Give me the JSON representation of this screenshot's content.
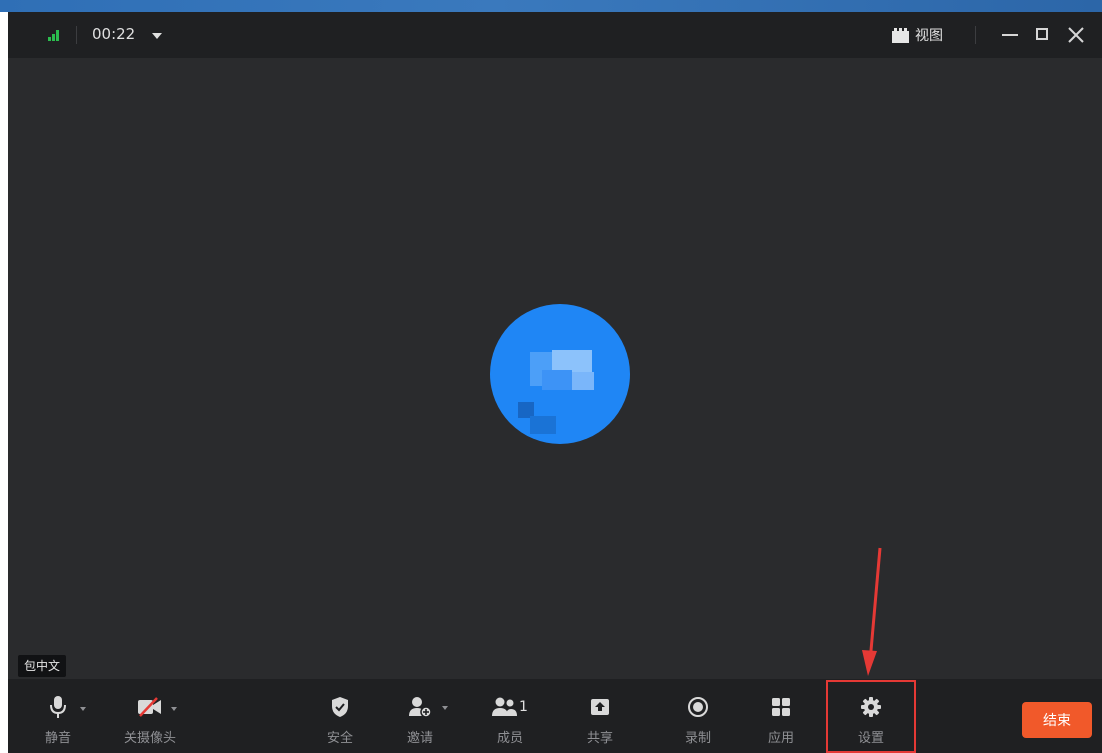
{
  "titlebar": {
    "timer": "00:22",
    "view_label": "视图"
  },
  "participant": {
    "name_tag": "包中文"
  },
  "toolbar": {
    "mute": "静音",
    "camera_off": "关摄像头",
    "security": "安全",
    "invite": "邀请",
    "members": "成员",
    "members_count": "1",
    "share": "共享",
    "record": "录制",
    "apps": "应用",
    "settings": "设置",
    "end": "结束"
  },
  "colors": {
    "accent": "#1f86f5",
    "end_button": "#f1592a",
    "annotation": "#e53935",
    "signal": "#2bbd4e"
  },
  "icons": [
    "signal-icon",
    "chevron-down-icon",
    "view-grid-icon",
    "minimize-icon",
    "maximize-icon",
    "close-icon",
    "microphone-icon",
    "camera-off-icon",
    "shield-icon",
    "add-person-icon",
    "members-icon",
    "share-screen-icon",
    "record-icon",
    "apps-grid-icon",
    "gear-icon"
  ]
}
